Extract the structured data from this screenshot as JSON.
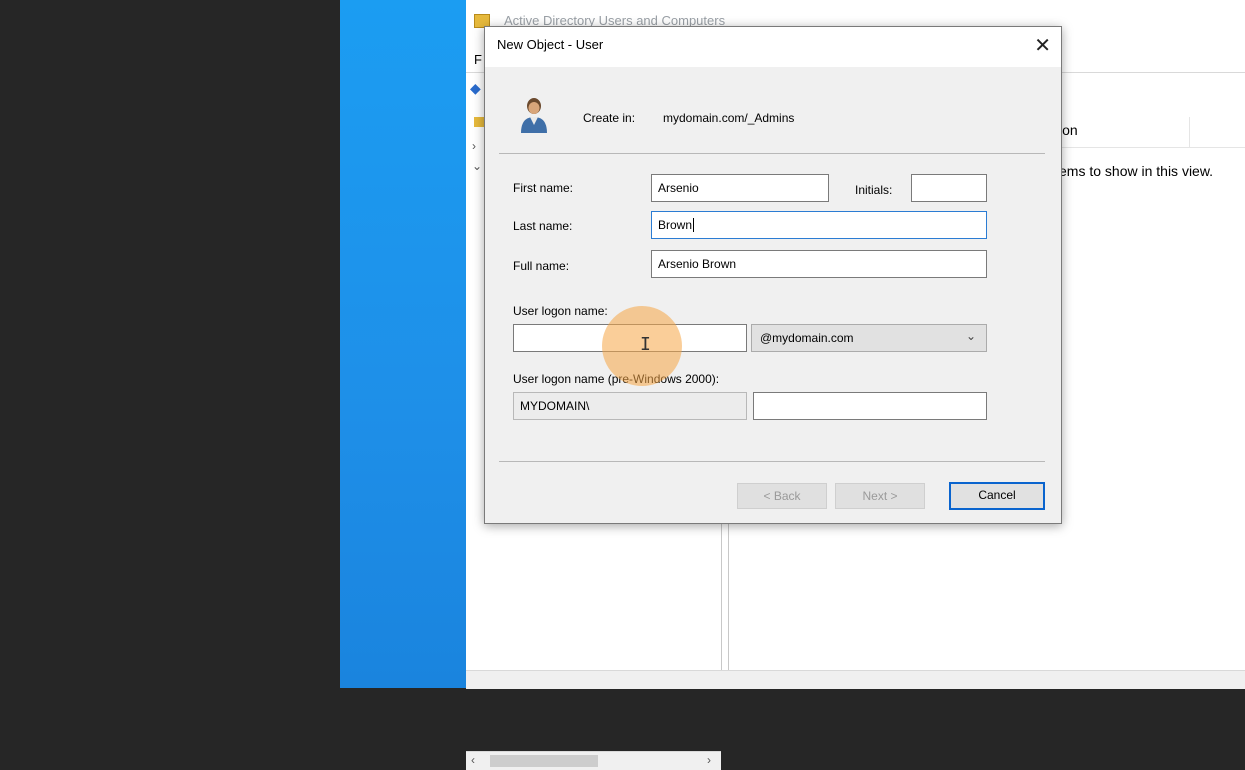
{
  "app": {
    "title": "Active Directory Users and Computers",
    "menu_stub": "F",
    "list_header_desc": "ion",
    "empty_message": "ems to show in this view."
  },
  "dialog": {
    "title": "New Object - User",
    "create_in_label": "Create in:",
    "create_in_value": "mydomain.com/_Admins",
    "first_name_label": "First name:",
    "first_name_value": "Arsenio",
    "initials_label": "Initials:",
    "initials_value": "",
    "last_name_label": "Last name:",
    "last_name_value": "Brown",
    "full_name_label": "Full name:",
    "full_name_value": "Arsenio Brown",
    "logon_name_label": "User logon name:",
    "logon_name_value": "",
    "domain_suffix": "@mydomain.com",
    "pre2000_label": "User logon name (pre-Windows 2000):",
    "pre2000_domain": "MYDOMAIN\\",
    "pre2000_value": "",
    "back_label": "< Back",
    "next_label": "Next >",
    "cancel_label": "Cancel",
    "close_glyph": "✕"
  },
  "colors": {
    "desktop_blue": "#1e8fe8",
    "focus_blue": "#2b7cd3",
    "cursor_highlight": "#f5a646"
  }
}
